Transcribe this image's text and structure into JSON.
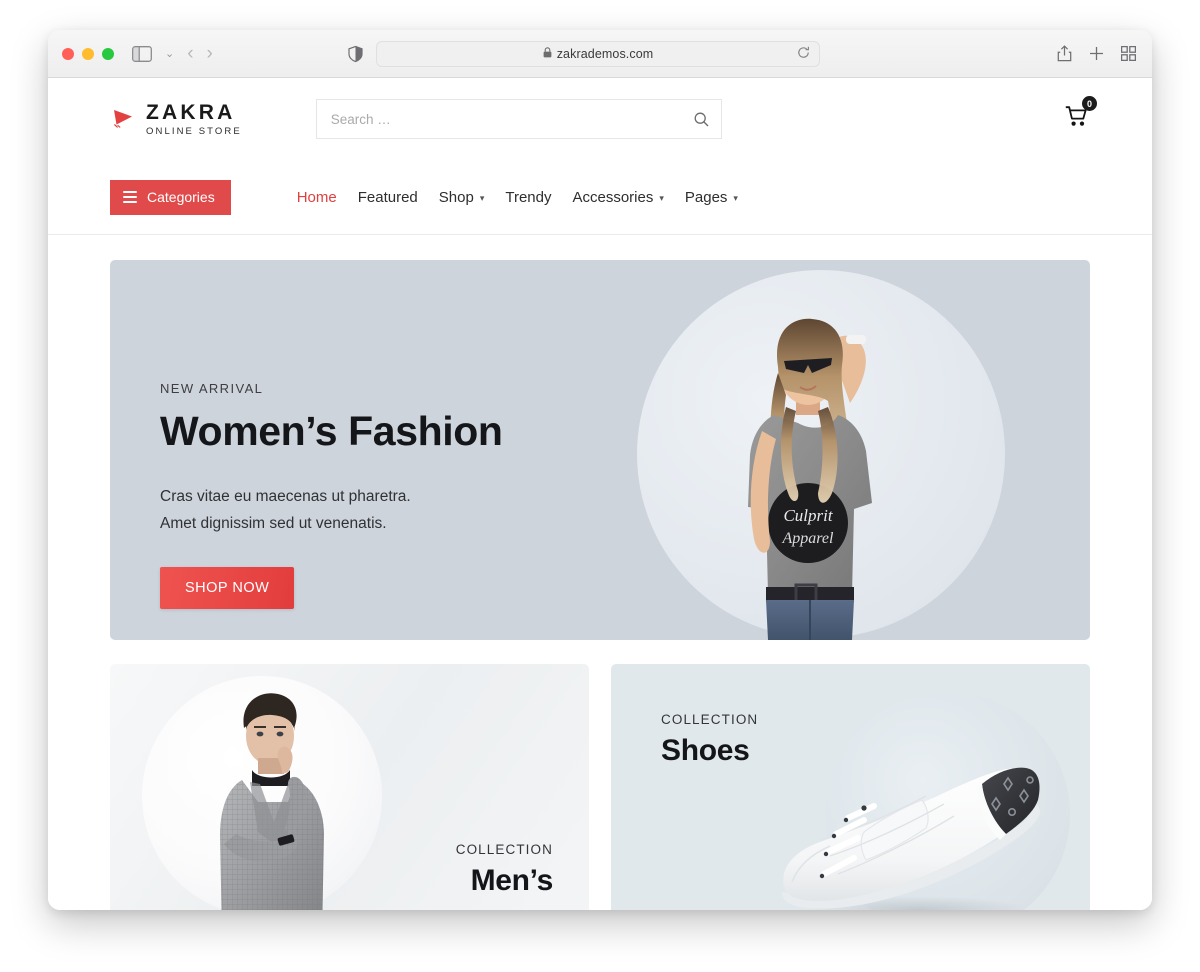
{
  "browser": {
    "url": "zakrademos.com",
    "lock_icon": "lock-icon",
    "reload_icon": "reload-icon",
    "shield_icon": "privacy-shield-icon",
    "sidebar_icon": "sidebar-toggle-icon",
    "tab_overview_icon": "tab-overview-icon",
    "share_icon": "share-icon",
    "new_tab_icon": "plus-icon",
    "back_icon": "back-arrow-icon",
    "forward_icon": "forward-arrow-icon",
    "dropdown_icon": "chevron-down-icon"
  },
  "site": {
    "logo": {
      "title": "ZAKRA",
      "subtitle": "ONLINE STORE",
      "mark": "play-triangle-icon"
    },
    "search": {
      "placeholder": "Search …",
      "value": "",
      "icon": "search-icon"
    },
    "cart": {
      "icon": "shopping-cart-icon",
      "count": "0"
    },
    "categories_button": {
      "label": "Categories",
      "icon": "hamburger-icon"
    },
    "nav": [
      {
        "label": "Home",
        "active": true,
        "caret": false
      },
      {
        "label": "Featured",
        "active": false,
        "caret": false
      },
      {
        "label": "Shop",
        "active": false,
        "caret": true
      },
      {
        "label": "Trendy",
        "active": false,
        "caret": false
      },
      {
        "label": "Accessories",
        "active": false,
        "caret": true
      },
      {
        "label": "Pages",
        "active": false,
        "caret": true
      }
    ]
  },
  "hero": {
    "eyebrow": "NEW ARRIVAL",
    "title": "Women’s Fashion",
    "desc_line1": "Cras vitae eu maecenas ut pharetra.",
    "desc_line2": "Amet dignissim sed ut venenatis.",
    "cta_label": "SHOP NOW",
    "image_alt": "woman-in-grey-tshirt",
    "shirt_print": "Culprit Apparel",
    "bg_color": "#ced4dc"
  },
  "cards": [
    {
      "eyebrow": "COLLECTION",
      "title": "Men’s",
      "image_alt": "man-in-grey-suit",
      "bg_color": "#f1f3f4"
    },
    {
      "eyebrow": "COLLECTION",
      "title": "Shoes",
      "image_alt": "white-sneaker",
      "bg_color": "#e1e8ec"
    }
  ],
  "colors": {
    "accent_red": "#e14a4a",
    "cta_red": "#e63f3f",
    "text_dark": "#15161a"
  }
}
